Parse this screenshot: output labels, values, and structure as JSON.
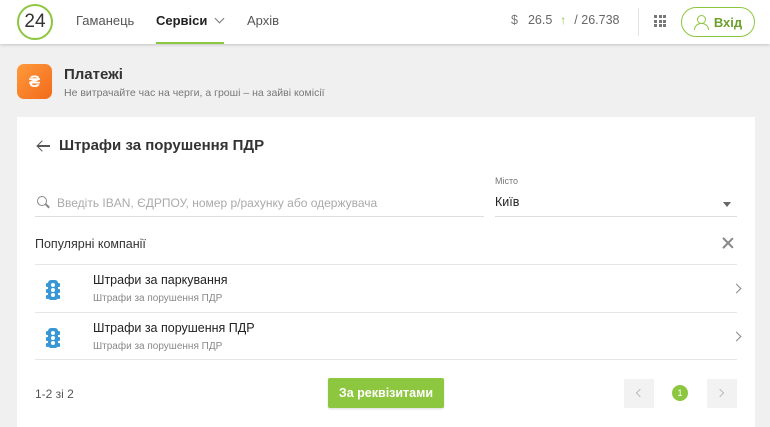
{
  "header": {
    "logo": "24",
    "nav": [
      {
        "label": "Гаманець",
        "active": false
      },
      {
        "label": "Сервіси",
        "active": true
      },
      {
        "label": "Архів",
        "active": false
      }
    ],
    "rate": {
      "currency_symbol": "$",
      "buy": "26.5",
      "sell": "/ 26.738",
      "trend": "↑"
    },
    "login_label": "Вхід"
  },
  "section": {
    "icon_symbol": "₴",
    "title": "Платежі",
    "subtitle": "Не витрачайте час на черги, а гроші – на зайві комісії"
  },
  "card": {
    "title": "Штрафи за порушення ПДР",
    "search": {
      "placeholder": "Введіть IBAN, ЄДРПОУ, номер р/рахунку або одержувача",
      "value": ""
    },
    "city": {
      "label": "Місто",
      "value": "Київ"
    },
    "popular_title": "Популярні компанії",
    "items": [
      {
        "name": "Штрафи за паркування",
        "subtitle": "Штрафи за порушення ПДР",
        "icon": "traffic-light-icon"
      },
      {
        "name": "Штрафи за порушення ПДР",
        "subtitle": "Штрафи за порушення ПДР",
        "icon": "traffic-light-icon"
      }
    ],
    "pager": {
      "count": "1-2 зі 2",
      "current_page": "1"
    },
    "details_button": "За реквізитами"
  },
  "colors": {
    "accent": "#8dc63f",
    "payments_icon": "#f47b28",
    "traffic_icon": "#3a97d6"
  }
}
